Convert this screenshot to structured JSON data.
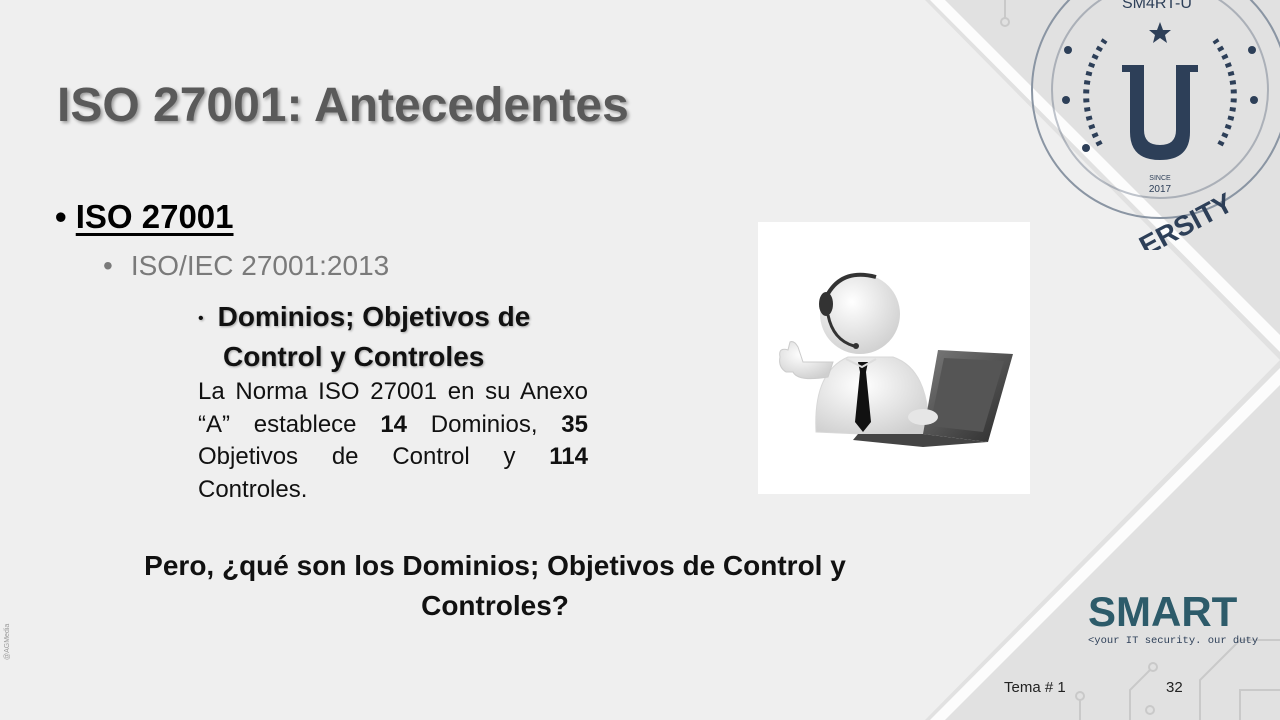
{
  "slide": {
    "title": "ISO 27001: Antecedentes",
    "level1": {
      "bullet": "•",
      "text": "ISO 27001"
    },
    "level2": {
      "bullet": "•",
      "text": "ISO/IEC 27001:2013"
    },
    "level3": {
      "bullet": "•",
      "line1": "Dominios; Objetivos de",
      "line2": "Control y  Controles"
    },
    "paragraph": {
      "p1": "La Norma ISO 27001 en su Anexo “A” establece ",
      "n1": "14",
      "p2": " Dominios, ",
      "n2": "35",
      "p3": " Objetivos de Control y ",
      "n3": "114",
      "p4": " Controles."
    },
    "question": "Pero, ¿qué son los Dominios; Objetivos de Control y Controles?"
  },
  "badge": {
    "top_text": "SM4RT-U",
    "letter": "U",
    "since": "SINCE",
    "year": "2017",
    "bottom_text": "ERSITY"
  },
  "logo": {
    "name": "SMART",
    "tagline": "<your IT security. our duty|"
  },
  "footer": {
    "topic": "Tema # 1",
    "page": "32"
  },
  "credit": "@AGMedia",
  "colors": {
    "navy": "#2d3f58",
    "teal": "#36807a",
    "title_gray": "#5a5a5a"
  }
}
